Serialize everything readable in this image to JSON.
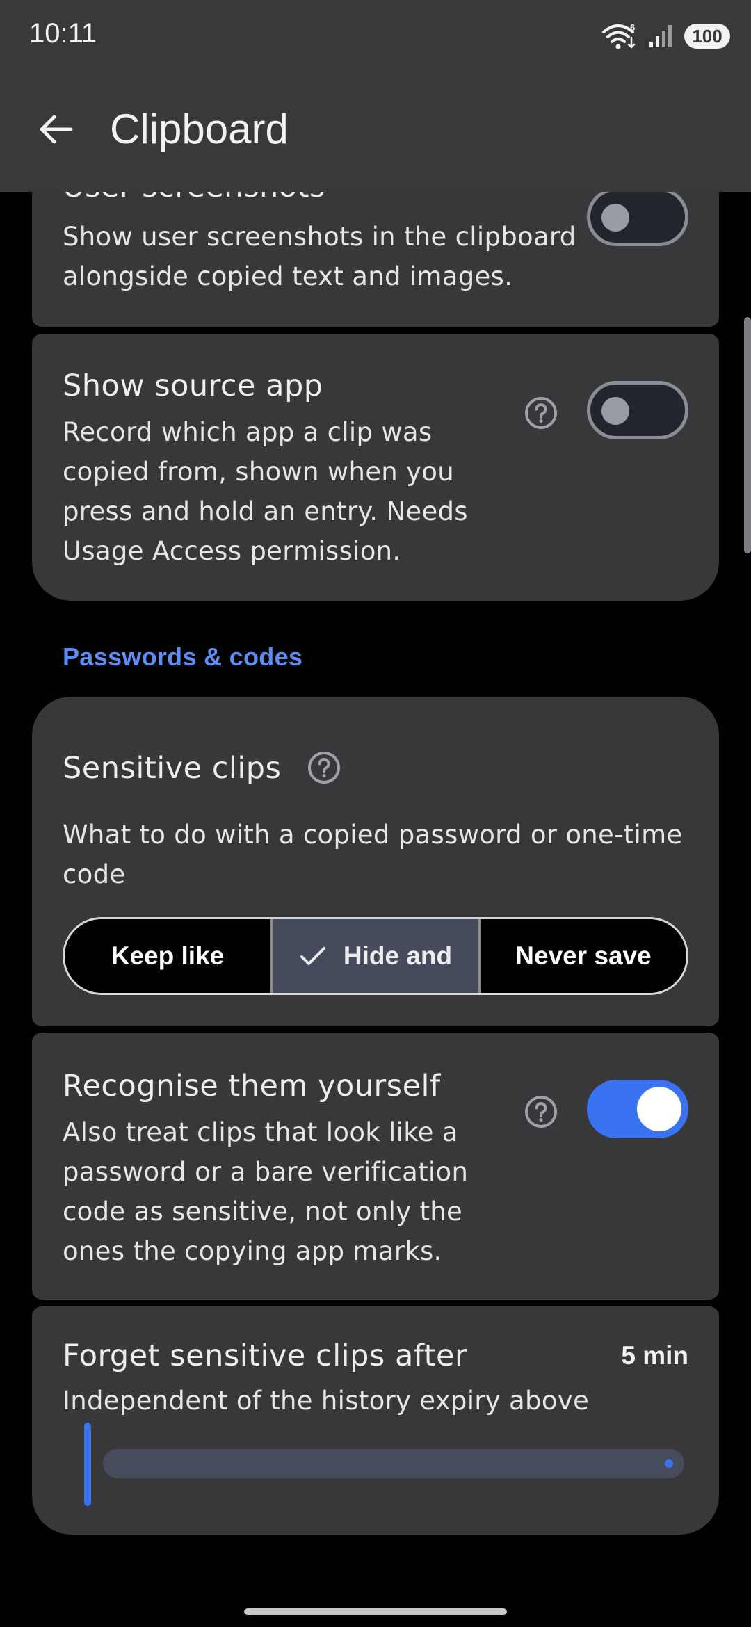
{
  "status_bar": {
    "time": "10:11",
    "battery": "100",
    "wifi_badge": "6"
  },
  "app_bar": {
    "title": "Clipboard"
  },
  "settings": {
    "user_screenshots": {
      "title": "User screenshots",
      "description_line1": "Show user screenshots in the clipboard",
      "description_line2": "alongside copied text and images.",
      "enabled": false
    },
    "show_source_app": {
      "title": "Show source app",
      "description_lines": [
        "Record which app a clip was",
        "copied from, shown when you",
        "press and hold an entry. Needs",
        "Usage Access permission."
      ],
      "enabled": false
    },
    "section_passwords": "Passwords & codes",
    "sensitive_clips": {
      "title": "Sensitive clips",
      "description_lines": [
        "What to do with a copied password or one-time",
        "code"
      ],
      "options": [
        "Keep like",
        "Hide and",
        "Never save"
      ],
      "selected_index": 1
    },
    "recognise_them_yourself": {
      "title": "Recognise them yourself",
      "description_lines": [
        "Also treat clips that look like a",
        "password or a bare verification",
        "code as sensitive, not only the",
        "ones the copying app marks."
      ],
      "enabled": true
    },
    "forget_sensitive": {
      "title": "Forget sensitive clips after",
      "value": "5 min",
      "description": "Independent of the history expiry above",
      "slider_fraction": 0.0
    }
  },
  "colors": {
    "accent": "#3A73F2",
    "section_header": "#5B8DF5",
    "card_bg": "#38383A",
    "app_bar_bg": "#39393B"
  }
}
